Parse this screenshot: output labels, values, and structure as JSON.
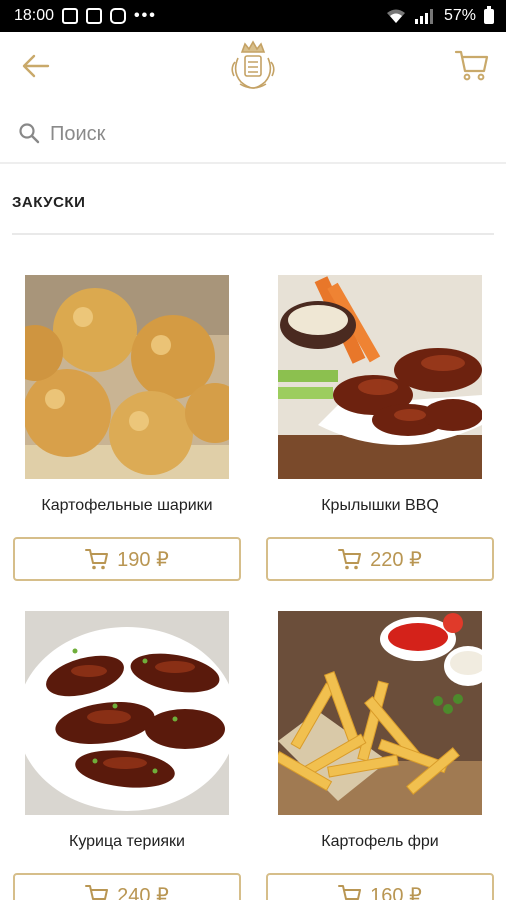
{
  "status_bar": {
    "time": "18:00",
    "more": "•••",
    "battery": "57%"
  },
  "search": {
    "placeholder": "Поиск",
    "value": ""
  },
  "section": {
    "title": "ЗАКУСКИ"
  },
  "products": [
    {
      "name": "Картофельные шарики",
      "price": "190 ₽"
    },
    {
      "name": "Крылышки BBQ",
      "price": "220 ₽"
    },
    {
      "name": "Курица терияки",
      "price": "240 ₽"
    },
    {
      "name": "Картофель фри",
      "price": "160 ₽"
    }
  ],
  "colors": {
    "accent": "#b99653",
    "accent_border": "#d6be8a",
    "divider": "#eeeeee"
  },
  "icons": {
    "back": "arrow-left-icon",
    "cart": "cart-icon",
    "search": "search-icon",
    "logo": "crown-crest-logo"
  }
}
